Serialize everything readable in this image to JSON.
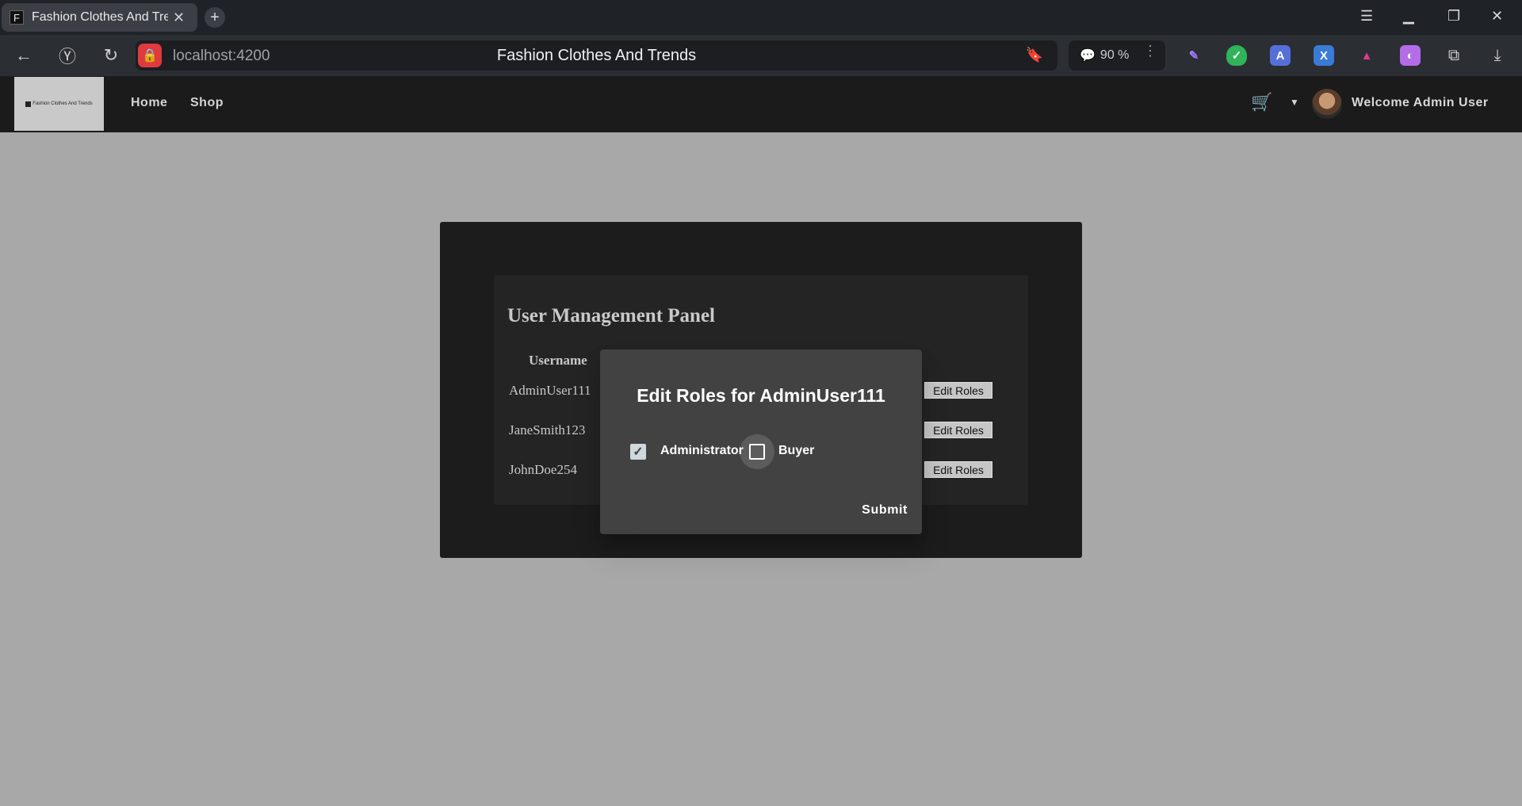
{
  "browser": {
    "tab_title": "Fashion Clothes And Trends",
    "tab_favicon": "F",
    "url": "localhost:4200",
    "page_title": "Fashion Clothes And Trends",
    "zoom": "90 %"
  },
  "site": {
    "logo_text": "Fashion Clothes And Trends",
    "nav": {
      "home": "Home",
      "shop": "Shop"
    },
    "welcome": "Welcome Admin User"
  },
  "panel": {
    "title": "User Management Panel",
    "column_username": "Username",
    "users": [
      {
        "username": "AdminUser111",
        "action": "Edit Roles"
      },
      {
        "username": "JaneSmith123",
        "action": "Edit Roles"
      },
      {
        "username": "JohnDoe254",
        "action": "Edit Roles"
      }
    ]
  },
  "dialog": {
    "title": "Edit Roles for AdminUser111",
    "roles": [
      {
        "label": "Administrator",
        "checked": true
      },
      {
        "label": "Buyer",
        "checked": false
      }
    ],
    "submit_label": "Submit"
  },
  "colors": {
    "page_background": "#a8a8a8",
    "navbar": "#1b1b1b",
    "panel_outer": "#1c1c1c",
    "panel_inner": "#242424",
    "dialog": "#424242"
  }
}
